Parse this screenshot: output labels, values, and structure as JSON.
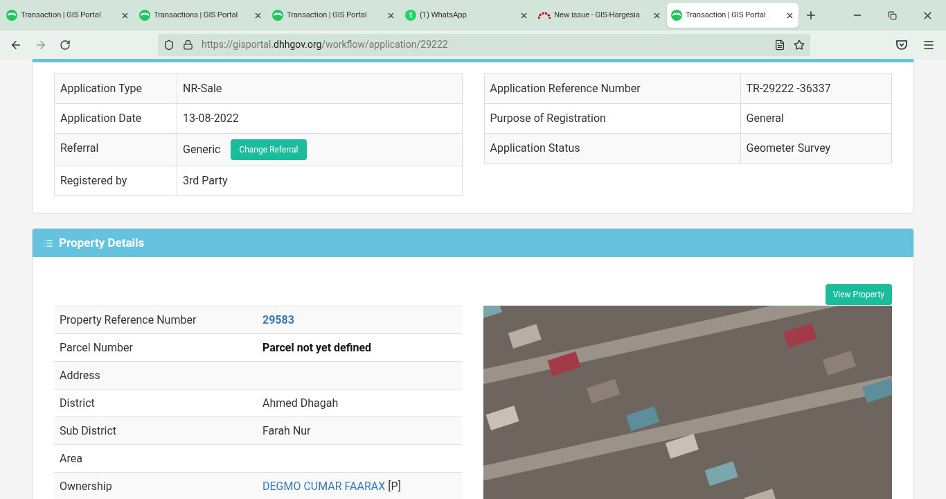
{
  "browser": {
    "tabs": [
      {
        "title": "Transaction | GIS Portal",
        "kind": "portal",
        "selected": false
      },
      {
        "title": "Transactions | GIS Portal",
        "kind": "portal",
        "selected": false
      },
      {
        "title": "Transaction | GIS Portal",
        "kind": "portal",
        "selected": false
      },
      {
        "title": "(1) WhatsApp",
        "kind": "chat",
        "badge": "1",
        "selected": false
      },
      {
        "title": "New issue - GIS-Hargesia",
        "kind": "tracker",
        "selected": false
      },
      {
        "title": "Transaction | GIS Portal",
        "kind": "portal",
        "selected": true
      }
    ],
    "url": {
      "prefix": "https://gisportal.",
      "domain": "dhhgov.org",
      "path": "/workflow/application/29222"
    }
  },
  "application": {
    "left_rows": [
      {
        "label": "Application Type",
        "value": "NR-Sale"
      },
      {
        "label": "Application Date",
        "value": "13-08-2022"
      },
      {
        "label": "Referral",
        "value": "Generic",
        "button": "Change Referral"
      },
      {
        "label": "Registered by",
        "value": "3rd Party"
      }
    ],
    "right_rows": [
      {
        "label": "Application Reference Number",
        "value": "TR-29222 -36337"
      },
      {
        "label": "Purpose of Registration",
        "value": "General"
      },
      {
        "label": "Application Status",
        "value": "Geometer Survey"
      }
    ]
  },
  "property": {
    "title": "Property Details",
    "view_button": "View Property",
    "rows": [
      {
        "label": "Property Reference Number",
        "kind": "link-bold",
        "value": "29583"
      },
      {
        "label": "Parcel Number",
        "kind": "bold",
        "value": "Parcel not yet defined"
      },
      {
        "label": "Address",
        "kind": "text"
      },
      {
        "label": "District",
        "kind": "text",
        "value": "Ahmed Dhagah"
      },
      {
        "label": "Sub District",
        "kind": "text",
        "value": "Farah Nur"
      },
      {
        "label": "Area",
        "kind": "text"
      },
      {
        "label": "Ownership",
        "kind": "link",
        "value": "DEGMO CUMAR FAARAX",
        "suffix": "[P]"
      }
    ]
  }
}
